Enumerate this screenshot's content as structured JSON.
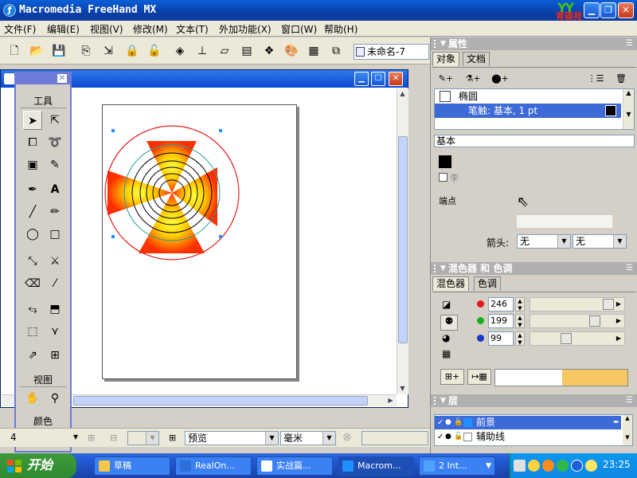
{
  "window": {
    "title": "Macromedia FreeHand MX"
  },
  "logo": {
    "text": "育碟苑"
  },
  "menu": [
    "文件(F)",
    "编辑(E)",
    "视图(V)",
    "修改(M)",
    "文本(T)",
    "外加功能(X)",
    "窗口(W)",
    "帮助(H)"
  ],
  "toolbar": {
    "document_select": "未命名-7"
  },
  "tools_panel": {
    "sections": {
      "tools": "工具",
      "view": "视图",
      "color": "颜色"
    }
  },
  "properties_panel": {
    "title": "属性",
    "tabs": [
      "对象",
      "文档"
    ],
    "objects": [
      {
        "label": "椭圆"
      },
      {
        "label": "笔触: 基本, 1 pt"
      }
    ],
    "fill_type": "基本",
    "endpoint_label": "端点",
    "arrowhead_label": "箭头:",
    "arrow_start": "无",
    "arrow_end": "无",
    "partial_label": "李"
  },
  "mixer_panel": {
    "title": "混色器 和 色调",
    "tabs": [
      "混色器",
      "色调"
    ],
    "rgb": [
      {
        "channel": "red",
        "value": "246",
        "color": "#e01818",
        "level": 0.965
      },
      {
        "channel": "green",
        "value": "199",
        "color": "#18b018",
        "level": 0.78
      },
      {
        "channel": "blue",
        "value": "99",
        "color": "#1838c8",
        "level": 0.388
      }
    ],
    "swatch_color": "#f6c763"
  },
  "layers_panel": {
    "title": "层",
    "layers": [
      {
        "name": "前景",
        "color": "#1e90ff"
      },
      {
        "name": "辅助线",
        "color": "#ffffff"
      }
    ]
  },
  "status_bar": {
    "zoom": "4",
    "view_mode": "预览",
    "units": "毫米"
  },
  "taskbar": {
    "start": "开始",
    "tasks": [
      {
        "label": "草稿",
        "icon_color": "#f3c74a"
      },
      {
        "label": "RealOn...",
        "icon_color": "#2b6fd8"
      },
      {
        "label": "实战篇...",
        "icon_color": "#ffffff"
      },
      {
        "label": "Macrom...",
        "icon_color": "#1e90ff"
      },
      {
        "label": "2 Int...",
        "icon_color": "#4fa3ff"
      }
    ],
    "clock": "23:25"
  }
}
